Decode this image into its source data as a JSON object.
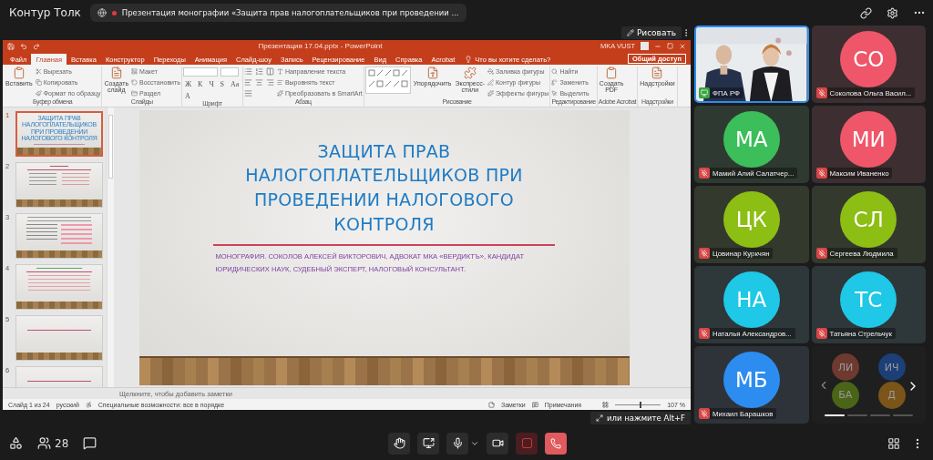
{
  "app": {
    "title": "Контур Толк",
    "meeting_title": "Презентация монографии «Защита прав налогоплательщиков при проведении ...",
    "recording": true
  },
  "share": {
    "draw_button": "Рисовать",
    "fullscreen_hint": "или нажмите Alt+F"
  },
  "powerpoint": {
    "title": "Презентация 17.04.pptx  -  PowerPoint",
    "user": "MKA VUST",
    "tabs": [
      {
        "label": "Файл",
        "selected": false
      },
      {
        "label": "Главная",
        "selected": true
      },
      {
        "label": "Вставка",
        "selected": false
      },
      {
        "label": "Конструктор",
        "selected": false
      },
      {
        "label": "Переходы",
        "selected": false
      },
      {
        "label": "Анимация",
        "selected": false
      },
      {
        "label": "Слайд-шоу",
        "selected": false
      },
      {
        "label": "Запись",
        "selected": false
      },
      {
        "label": "Рецензирование",
        "selected": false
      },
      {
        "label": "Вид",
        "selected": false
      },
      {
        "label": "Справка",
        "selected": false
      },
      {
        "label": "Acrobat",
        "selected": false
      }
    ],
    "search": "Что вы хотите сделать?",
    "share_button": "Общий доступ",
    "groups": [
      {
        "label": "Буфер обмена",
        "items": [
          {
            "kind": "large",
            "label": "Вставить"
          },
          {
            "kind": "small",
            "label": "Вырезать"
          },
          {
            "kind": "small",
            "label": "Копировать"
          },
          {
            "kind": "small",
            "label": "Формат по образцу"
          }
        ]
      },
      {
        "label": "Слайды",
        "items": [
          {
            "kind": "large",
            "label": "Создать слайд"
          },
          {
            "kind": "small",
            "label": "Макет"
          },
          {
            "kind": "small",
            "label": "Восстановить"
          },
          {
            "kind": "small",
            "label": "Раздел"
          }
        ]
      },
      {
        "label": "Шрифт",
        "items": [
          {
            "kind": "combo"
          },
          {
            "kind": "combo"
          },
          {
            "kind": "glyph",
            "label": "Ж"
          },
          {
            "kind": "glyph",
            "label": "К"
          },
          {
            "kind": "glyph",
            "label": "Ч"
          },
          {
            "kind": "glyph",
            "label": "S"
          },
          {
            "kind": "glyph",
            "label": "Aa"
          },
          {
            "kind": "glyph",
            "label": "A"
          }
        ]
      },
      {
        "label": "Абзац",
        "items": [
          {
            "kind": "icons"
          },
          {
            "kind": "small",
            "label": "Направление текста"
          },
          {
            "kind": "small",
            "label": "Выровнять текст"
          },
          {
            "kind": "small",
            "label": "Преобразовать в SmartArt"
          }
        ]
      },
      {
        "label": "Рисование",
        "items": [
          {
            "kind": "gallery"
          },
          {
            "kind": "large",
            "label": "Упорядочить"
          },
          {
            "kind": "large",
            "label": "Экспресс-стили"
          },
          {
            "kind": "small",
            "label": "Заливка фигуры"
          },
          {
            "kind": "small",
            "label": "Контур фигуры"
          },
          {
            "kind": "small",
            "label": "Эффекты фигуры"
          }
        ]
      },
      {
        "label": "Редактирование",
        "items": [
          {
            "kind": "small",
            "label": "Найти"
          },
          {
            "kind": "small",
            "label": "Заменить"
          },
          {
            "kind": "small",
            "label": "Выделить"
          }
        ]
      },
      {
        "label": "Adobe Acrobat",
        "items": [
          {
            "kind": "large",
            "label": "Создать PDF"
          }
        ]
      },
      {
        "label": "Надстройки",
        "items": [
          {
            "kind": "large",
            "label": "Надстройки"
          }
        ]
      }
    ],
    "thumbnails": [
      {
        "number": "1",
        "selected": true,
        "kind": "title",
        "title": "ЗАЩИТА ПРАВ НАЛОГОПЛАТЕЛЬЩИКОВ ПРИ ПРОВЕДЕНИИ НАЛОГОВОГО КОНТРОЛЯ"
      },
      {
        "number": "2",
        "selected": false,
        "kind": "columns"
      },
      {
        "number": "3",
        "selected": false,
        "kind": "text"
      },
      {
        "number": "4",
        "selected": false,
        "kind": "list"
      },
      {
        "number": "5",
        "selected": false,
        "kind": "blank"
      },
      {
        "number": "6",
        "selected": false,
        "kind": "blank"
      }
    ],
    "slide": {
      "title": "ЗАЩИТА ПРАВ НАЛОГОПЛАТЕЛЬЩИКОВ ПРИ ПРОВЕДЕНИИ НАЛОГОВОГО КОНТРОЛЯ",
      "subtitle": "МОНОГРАФИЯ. СОКОЛОВ АЛЕКСЕЙ ВИКТОРОВИЧ, АДВОКАТ МКА «ВЕРДИКТЪ», КАНДИДАТ ЮРИДИЧЕСКИХ НАУК, СУДЕБНЫЙ ЭКСПЕРТ, НАЛОГОВЫЙ КОНСУЛЬТАНТ."
    },
    "notes_placeholder": "Щелкните, чтобы добавить заметки",
    "status": {
      "slide": "Слайд 1 из 24",
      "language": "русский",
      "accessibility": "Специальные возможности: все в порядке",
      "notes": "Заметки",
      "comments": "Примечания",
      "zoom_slider": {
        "level": 0.55
      },
      "zoom": "107 %"
    }
  },
  "presenter": {
    "kind": "video",
    "name": "ФПА РФ",
    "selected": true
  },
  "participants": [
    {
      "kind": "avatar",
      "initials": "СО",
      "name": "Соколова Ольга Васил...",
      "color": "#f0566a",
      "muted": true,
      "selected": false
    },
    {
      "kind": "avatar",
      "initials": "МА",
      "name": "Мамий Алий Салатчер...",
      "color": "#3cbe5a",
      "muted": true,
      "selected": false
    },
    {
      "kind": "avatar",
      "initials": "МИ",
      "name": "Максим Иваненко",
      "color": "#f0566a",
      "muted": true,
      "selected": false
    },
    {
      "kind": "avatar",
      "initials": "ЦК",
      "name": "Цовинар Куркчян",
      "color": "#8cbe14",
      "muted": true,
      "selected": false
    },
    {
      "kind": "avatar",
      "initials": "СЛ",
      "name": "Сергеева Людмила",
      "color": "#8cbe14",
      "muted": true,
      "selected": false
    },
    {
      "kind": "avatar",
      "initials": "НА",
      "name": "Наталья Александров...",
      "color": "#1ec8e6",
      "muted": true,
      "selected": false
    },
    {
      "kind": "avatar",
      "initials": "ТС",
      "name": "Татьяна Стрельчук",
      "color": "#1ec8e6",
      "muted": true,
      "selected": false
    },
    {
      "kind": "avatar",
      "initials": "МБ",
      "name": "Михаил Барашков",
      "color": "#2d8cf0",
      "muted": true,
      "selected": false
    }
  ],
  "more_participants": [
    {
      "initials": "ЛИ",
      "color": "#6e3a30"
    },
    {
      "initials": "ИЧ",
      "color": "#1c3f78"
    },
    {
      "initials": "БА",
      "color": "#4a6418"
    },
    {
      "initials": "Д",
      "color": "#7a5418"
    }
  ],
  "toolbar": {
    "participant_count": "28"
  }
}
